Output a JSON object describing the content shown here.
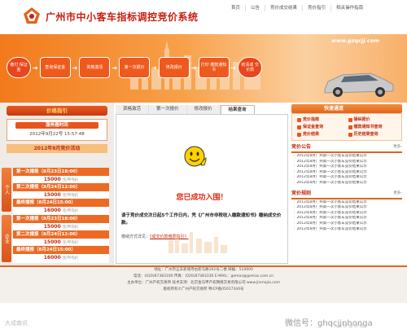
{
  "header": {
    "site_title": "广州市中小客车指标调控竞价系统",
    "nav": [
      "首页",
      "公告",
      "竞价成交结果",
      "竞价指引",
      "相关操作指南"
    ]
  },
  "banner": {
    "url_text": "www.gzqcjj.com",
    "steps": [
      "缴付\n保证金",
      "查询保证金",
      "资格激活",
      "第一次报价",
      "修改报价",
      "打印\n缴款通知书",
      "结清成\n交价款"
    ]
  },
  "left": {
    "title": "价格指引",
    "server_time_label": "服务器时间",
    "server_time_value": "2012年9月22号 15:57:48",
    "activity_title": "2012年8月竞价活动",
    "side_tab_personal": "个人",
    "side_tab_company": "企业",
    "sessions": [
      {
        "title": "第一次播报（8月23日18:00）",
        "price": "15000",
        "unit": "元/平均价"
      },
      {
        "title": "第二次播报（8月24日12:00）",
        "price": "15000",
        "unit": "元/平均价"
      },
      {
        "title": "最终播报（8月24日15:00）",
        "price": "16000",
        "unit": "元/平均价"
      },
      {
        "title": "第一次播报（8月23日18:00）",
        "price": "15000",
        "unit": "元/平均价"
      },
      {
        "title": "第二次播报（8月24日12:00）",
        "price": "15000",
        "unit": "元/平均价"
      },
      {
        "title": "最终播报（8月24日15:00）",
        "price": "16000",
        "unit": "元/平均价"
      }
    ]
  },
  "center": {
    "tabs": [
      "资格激活",
      "第一次报价",
      "修改报价",
      "结果查询"
    ],
    "success": "您已成功入围！",
    "notice": "请于竞价成交次日起5个工作日内，凭《广州市非税收入缴款通知书》缴纳成交价款。",
    "pay_prefix": "缴纳方式详见：",
    "pay_link": "《成交价款缴费指引》"
  },
  "right": {
    "quick_title": "快速通道",
    "quicklinks": [
      "竞价指南",
      "操纵报价",
      "保证金查询",
      "缴款通知书查询",
      "竞价结果",
      "历史结果查询"
    ],
    "ann_title": "竞价公告",
    "ann_more": "更多›",
    "ann_items": [
      "2012年8月广州第一次小客车竞价结果公示",
      "2012年8月广州第一次小客车竞价结果公示",
      "2012年8月广州第一次小客车竞价结果公示",
      "2012年8月广州第一次小客车竞价结果公示",
      "2012年8月广州第一次小客车竞价结果公示",
      "2012年8月广州第一次小客车竞价结果公示"
    ],
    "rule_title": "竞价规则",
    "rule_more": "更多›",
    "rule_items": [
      "2012年8月广州第一次小客车竞价结果公示",
      "2012年8月广州第一次小客车竞价结果公示",
      "2012年8月广州第一次小客车竞价结果公示",
      "2012年8月广州第一次小客车竞价结果公示",
      "2012年8月广州第一次小客车竞价结果公示",
      "2012年8月广州第一次小客车竞价结果公示"
    ]
  },
  "footer": {
    "lines": [
      "地址：广州市五羊新城寺右新马路162号二楼    邮编：510600",
      "电话：(020)87383100    传真：(020)87383336    E-MAIL：gemas@gemas.com.cn",
      "主办单位：广州产权交易所    技术支持：北京金马甲产权网络交易有限公司  www.jinmajia.com",
      "版权所有©广州产权交易所    粤ICP备05017344号"
    ]
  },
  "watermark": {
    "left": "大成南讯",
    "right": "微信号：ghqcjjnhonga",
    "right_sub": "大单 拼 通 讯 有"
  },
  "colors": {
    "brand_red": "#c81e12",
    "orange": "#e3641c"
  }
}
